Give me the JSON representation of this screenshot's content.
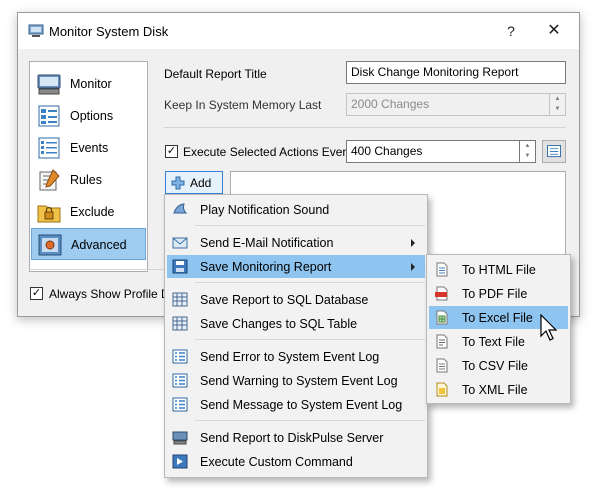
{
  "window": {
    "title": "Monitor System Disk",
    "help_glyph": "?",
    "close_glyph": "✕"
  },
  "nav": {
    "items": [
      {
        "label": "Monitor",
        "icon": "monitor-icon"
      },
      {
        "label": "Options",
        "icon": "options-icon"
      },
      {
        "label": "Events",
        "icon": "events-icon"
      },
      {
        "label": "Rules",
        "icon": "rules-icon"
      },
      {
        "label": "Exclude",
        "icon": "exclude-icon"
      },
      {
        "label": "Advanced",
        "icon": "advanced-icon",
        "selected": true
      }
    ]
  },
  "form": {
    "report_title_label": "Default Report Title",
    "report_title_value": "Disk Change Monitoring Report",
    "memory_label": "Keep In System Memory Last",
    "memory_value": "2000 Changes",
    "execute_label": "Execute Selected Actions Every",
    "execute_value": "400 Changes",
    "execute_checked": true,
    "add_label": "Add",
    "show_profile_label": "Always Show Profile Dial",
    "show_profile_checked": true
  },
  "context_menu": {
    "items": [
      {
        "label": "Play Notification Sound",
        "icon": "sound-icon"
      },
      {
        "label": "Send E-Mail Notification",
        "icon": "email-icon",
        "submenu": true
      },
      {
        "label": "Save Monitoring Report",
        "icon": "save-icon",
        "submenu": true,
        "highlighted": true
      },
      {
        "label": "Save Report to SQL Database",
        "icon": "database-icon"
      },
      {
        "label": "Save Changes to SQL Table",
        "icon": "table-icon"
      },
      {
        "label": "Send Error to System Event Log",
        "icon": "event-log-icon"
      },
      {
        "label": "Send Warning to System Event Log",
        "icon": "event-log-icon"
      },
      {
        "label": "Send Message to System Event Log",
        "icon": "event-log-icon"
      },
      {
        "label": "Send Report to DiskPulse Server",
        "icon": "server-icon"
      },
      {
        "label": "Execute Custom Command",
        "icon": "command-icon"
      }
    ]
  },
  "submenu": {
    "items": [
      {
        "label": "To HTML File",
        "icon": "html-file-icon"
      },
      {
        "label": "To PDF File",
        "icon": "pdf-file-icon"
      },
      {
        "label": "To Excel File",
        "icon": "excel-file-icon",
        "highlighted": true
      },
      {
        "label": "To Text File",
        "icon": "text-file-icon"
      },
      {
        "label": "To CSV File",
        "icon": "csv-file-icon"
      },
      {
        "label": "To XML File",
        "icon": "xml-file-icon"
      }
    ]
  },
  "colors": {
    "highlight": "#8ec4f0",
    "nav_selected": "#9ecbf0",
    "accent": "#3a80d7"
  }
}
